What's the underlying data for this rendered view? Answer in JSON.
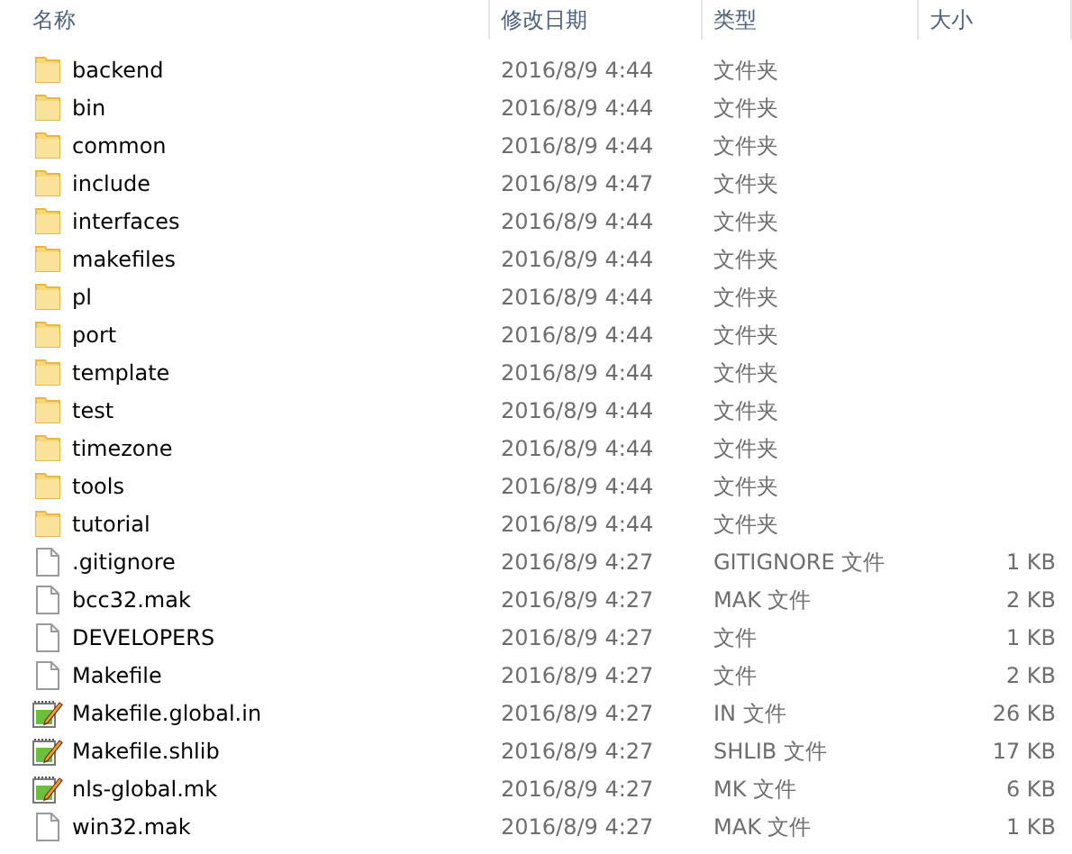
{
  "columns": [
    "名称",
    "修改日期",
    "类型",
    "大小"
  ],
  "rows": [
    {
      "kind": "folder",
      "name": "backend",
      "modified": "2016/8/9 4:44",
      "type": "文件夹"
    },
    {
      "kind": "folder",
      "name": "bin",
      "modified": "2016/8/9 4:44",
      "type": "文件夹"
    },
    {
      "kind": "folder",
      "name": "common",
      "modified": "2016/8/9 4:44",
      "type": "文件夹"
    },
    {
      "kind": "folder",
      "name": "include",
      "modified": "2016/8/9 4:47",
      "type": "文件夹"
    },
    {
      "kind": "folder",
      "name": "interfaces",
      "modified": "2016/8/9 4:44",
      "type": "文件夹"
    },
    {
      "kind": "folder",
      "name": "makefiles",
      "modified": "2016/8/9 4:44",
      "type": "文件夹"
    },
    {
      "kind": "folder",
      "name": "pl",
      "modified": "2016/8/9 4:44",
      "type": "文件夹"
    },
    {
      "kind": "folder",
      "name": "port",
      "modified": "2016/8/9 4:44",
      "type": "文件夹"
    },
    {
      "kind": "folder",
      "name": "template",
      "modified": "2016/8/9 4:44",
      "type": "文件夹"
    },
    {
      "kind": "folder",
      "name": "test",
      "modified": "2016/8/9 4:44",
      "type": "文件夹"
    },
    {
      "kind": "folder",
      "name": "timezone",
      "modified": "2016/8/9 4:44",
      "type": "文件夹"
    },
    {
      "kind": "folder",
      "name": "tools",
      "modified": "2016/8/9 4:44",
      "type": "文件夹"
    },
    {
      "kind": "folder",
      "name": "tutorial",
      "modified": "2016/8/9 4:44",
      "type": "文件夹"
    },
    {
      "kind": "file",
      "name": ".gitignore",
      "modified": "2016/8/9 4:27",
      "type": "GITIGNORE 文件",
      "size": "1 KB"
    },
    {
      "kind": "file",
      "name": "bcc32.mak",
      "modified": "2016/8/9 4:27",
      "type": "MAK 文件",
      "size": "2 KB"
    },
    {
      "kind": "file",
      "name": "DEVELOPERS",
      "modified": "2016/8/9 4:27",
      "type": "文件",
      "size": "1 KB"
    },
    {
      "kind": "file",
      "name": "Makefile",
      "modified": "2016/8/9 4:27",
      "type": "文件",
      "size": "2 KB"
    },
    {
      "kind": "script",
      "name": "Makefile.global.in",
      "modified": "2016/8/9 4:27",
      "type": "IN 文件",
      "size": "26 KB"
    },
    {
      "kind": "script",
      "name": "Makefile.shlib",
      "modified": "2016/8/9 4:27",
      "type": "SHLIB 文件",
      "size": "17 KB"
    },
    {
      "kind": "script",
      "name": "nls-global.mk",
      "modified": "2016/8/9 4:27",
      "type": "MK 文件",
      "size": "6 KB"
    },
    {
      "kind": "file",
      "name": "win32.mak",
      "modified": "2016/8/9 4:27",
      "type": "MAK 文件",
      "size": "1 KB"
    }
  ]
}
